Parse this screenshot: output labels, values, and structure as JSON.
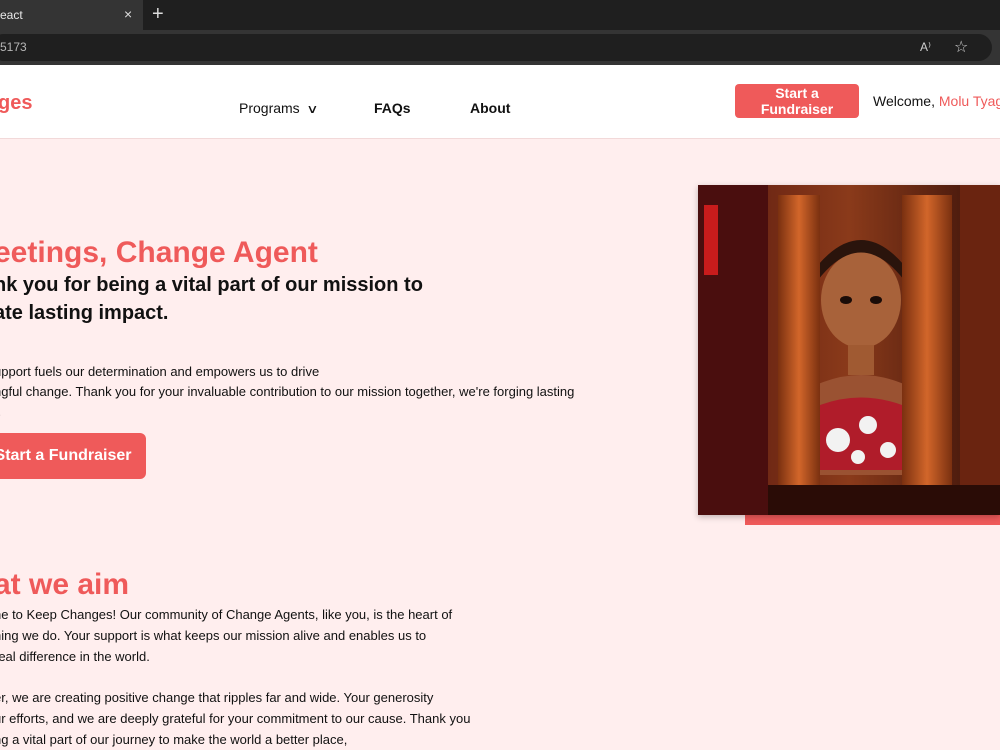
{
  "browser": {
    "tab_title": "eact",
    "tab_close": "×",
    "new_tab": "+",
    "url": "5173",
    "read_aloud": "A⁾",
    "favorite": "☆"
  },
  "header": {
    "logo": "ges",
    "nav": {
      "programs": "Programs",
      "faqs": "FAQs",
      "about": "About"
    },
    "button": "Start a Fundraiser",
    "welcome": "Welcome,",
    "user_name": "Molu Tyag"
  },
  "hero": {
    "title": "eetings, Change Agent",
    "subtitle": "nk you for being a vital part of our mission to\nate lasting impact.",
    "text": "upport fuels our determination and empowers us to drive\nngful change. Thank you for your invaluable contribution to our mission together, we're forging lasting\nt.",
    "button": "Start a Fundraiser"
  },
  "aim": {
    "title": "at we aim",
    "p1": "ne to Keep Changes! Our community of Change Agents, like you, is the heart of\nning we do. Your support is what keeps our mission alive and enables us to\nreal difference in the world.",
    "p2": "er, we are creating positive change that ripples far and wide. Your generosity\nur efforts, and we are deeply grateful for your commitment to our cause. Thank you\nng a vital part of our journey to make the world a better place,"
  },
  "colors": {
    "accent": "#ef5a5a",
    "page_bg": "#ffeeee"
  }
}
